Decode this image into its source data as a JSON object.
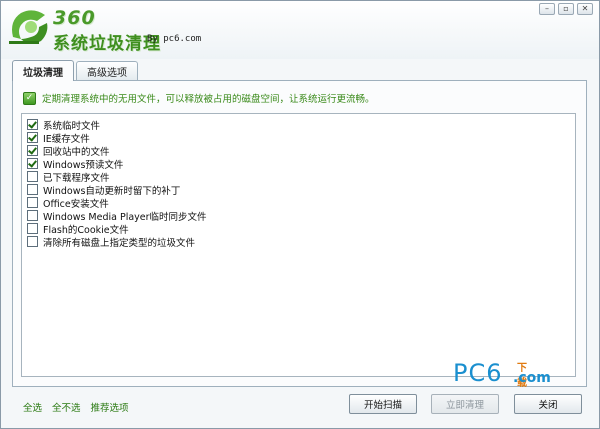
{
  "header": {
    "logo_brand": "360",
    "title": "系统垃圾清理",
    "by_text": "By  pc6.com"
  },
  "window_controls": {
    "minimize": "–",
    "restore": "▫",
    "close": "✕"
  },
  "tabs": [
    {
      "label": "垃圾清理",
      "active": true
    },
    {
      "label": "高级选项",
      "active": false
    }
  ],
  "hint": {
    "icon": "check-icon",
    "text": "定期清理系统中的无用文件，可以释放被占用的磁盘空间，让系统运行更流畅。"
  },
  "items": [
    {
      "label": "系统临时文件",
      "checked": true
    },
    {
      "label": "IE缓存文件",
      "checked": true
    },
    {
      "label": "回收站中的文件",
      "checked": true
    },
    {
      "label": "Windows预读文件",
      "checked": true
    },
    {
      "label": "已下载程序文件",
      "checked": false
    },
    {
      "label": "Windows自动更新时留下的补丁",
      "checked": false
    },
    {
      "label": "Office安装文件",
      "checked": false
    },
    {
      "label": "Windows Media Player临时同步文件",
      "checked": false
    },
    {
      "label": "Flash的Cookie文件",
      "checked": false
    },
    {
      "label": "清除所有磁盘上指定类型的垃圾文件",
      "checked": false
    }
  ],
  "watermark": {
    "pc": "PC6",
    "xiazai": "下载",
    "com": ".com"
  },
  "footer": {
    "links": [
      "全选",
      "全不选",
      "推荐选项"
    ],
    "scan_button": "开始扫描",
    "clean_button": "立即清理",
    "close_button": "关闭"
  },
  "colors": {
    "accent_green": "#3a8a1a",
    "watermark_blue": "#1a8fcf",
    "watermark_orange": "#e07a10"
  }
}
